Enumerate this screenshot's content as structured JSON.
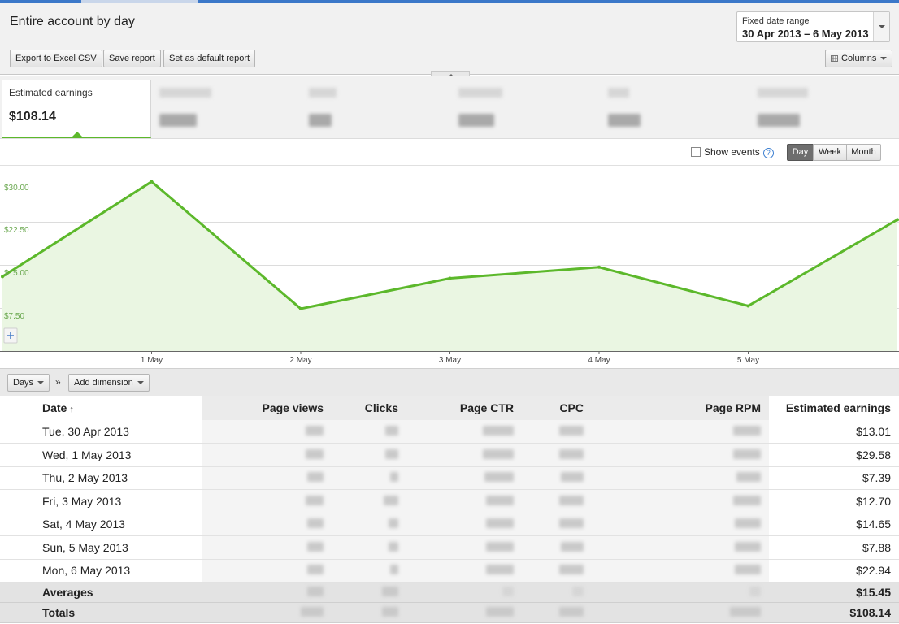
{
  "header": {
    "title": "Entire account by day",
    "date_range_label": "Fixed date range",
    "date_range_value": "30 Apr 2013 – 6 May 2013",
    "export_button": "Export to Excel CSV",
    "save_button": "Save report",
    "default_button": "Set as default report",
    "columns_button": "Columns"
  },
  "scorecard": {
    "label": "Estimated earnings",
    "value": "$108.14"
  },
  "chart_toolbar": {
    "show_events": "Show events",
    "help_glyph": "?",
    "granularity": [
      "Day",
      "Week",
      "Month"
    ],
    "active": "Day"
  },
  "chart_data": {
    "type": "area",
    "x": [
      "30 Apr",
      "1 May",
      "2 May",
      "3 May",
      "4 May",
      "5 May",
      "6 May"
    ],
    "x_tick_labels": [
      "1 May",
      "2 May",
      "3 May",
      "4 May",
      "5 May"
    ],
    "series": [
      {
        "values": [
          13.01,
          29.58,
          7.39,
          12.7,
          14.65,
          7.88,
          22.94
        ]
      }
    ],
    "y_ticks": [
      "$30.00",
      "$22.50",
      "$15.00",
      "$7.50"
    ],
    "y_tick_values": [
      30,
      22.5,
      15,
      7.5
    ],
    "ylim": [
      0,
      32.5
    ],
    "grid": true,
    "color": "#5cb82b",
    "fill": "#eaf6e2"
  },
  "controls": {
    "dimension_button": "Days",
    "separator": "»",
    "add_dimension_button": "Add dimension"
  },
  "table": {
    "columns": [
      "Date",
      "Page views",
      "Clicks",
      "Page CTR",
      "CPC",
      "Page RPM",
      "Estimated earnings"
    ],
    "sort_glyph": "↑",
    "rows": [
      {
        "date": "Tue, 30 Apr 2013",
        "earnings": "$13.01"
      },
      {
        "date": "Wed, 1 May 2013",
        "earnings": "$29.58"
      },
      {
        "date": "Thu, 2 May 2013",
        "earnings": "$7.39"
      },
      {
        "date": "Fri, 3 May 2013",
        "earnings": "$12.70"
      },
      {
        "date": "Sat, 4 May 2013",
        "earnings": "$14.65"
      },
      {
        "date": "Sun, 5 May 2013",
        "earnings": "$7.88"
      },
      {
        "date": "Mon, 6 May 2013",
        "earnings": "$22.94"
      }
    ],
    "averages": {
      "label": "Averages",
      "earnings": "$15.45"
    },
    "totals": {
      "label": "Totals",
      "earnings": "$108.14"
    }
  },
  "icons": {
    "columns": "columns-grid-icon",
    "zoom": "plus-icon",
    "collapse": "chevron-up-icon"
  },
  "colors": {
    "accent_green": "#5cb82b",
    "top_bar_blue": "#3b78c9",
    "active_segment": "#6e6e6e"
  }
}
